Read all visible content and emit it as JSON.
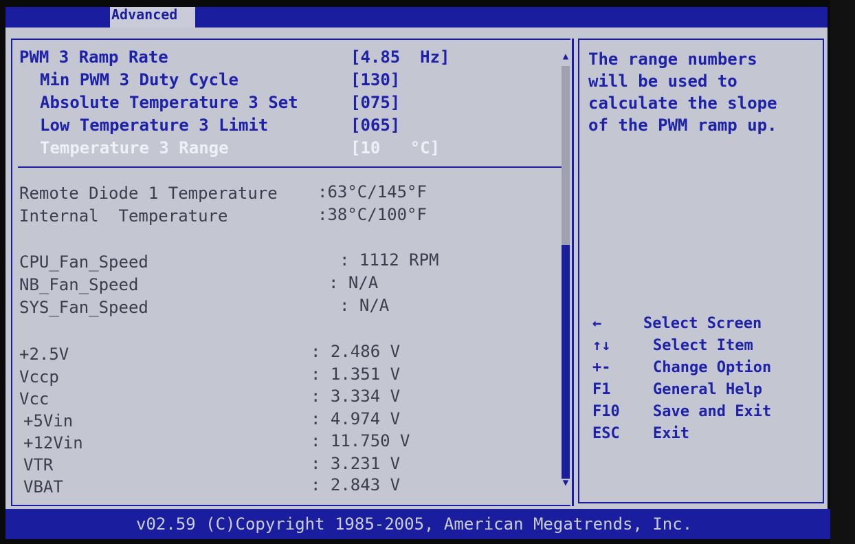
{
  "tab": {
    "label": "Advanced"
  },
  "settings": [
    {
      "name": "PWM 3 Ramp Rate",
      "value": "[4.85  Hz]"
    },
    {
      "name": "Min PWM 3 Duty Cycle",
      "value": "[130]"
    },
    {
      "name": "Absolute Temperature 3 Set",
      "value": "[075]"
    },
    {
      "name": "Low Temperature 3 Limit",
      "value": "[065]"
    },
    {
      "name": "Temperature 3 Range",
      "value": "[10   °C]"
    }
  ],
  "temperatures": [
    {
      "name": "Remote Diode 1 Temperature",
      "value": ":63°C/145°F"
    },
    {
      "name": "Internal  Temperature",
      "value": ":38°C/100°F"
    }
  ],
  "fans": [
    {
      "name": "CPU_Fan_Speed",
      "value": ": 1112 RPM"
    },
    {
      "name": "NB_Fan_Speed",
      "value": ": N/A"
    },
    {
      "name": "SYS_Fan_Speed",
      "value": ": N/A"
    }
  ],
  "voltages": [
    {
      "name": "+2.5V",
      "value": ": 2.486 V"
    },
    {
      "name": "Vccp",
      "value": ": 1.351 V"
    },
    {
      "name": "Vcc",
      "value": ": 3.334 V"
    },
    {
      "name": "+5Vin",
      "value": ": 4.974 V"
    },
    {
      "name": "+12Vin",
      "value": ": 11.750 V"
    },
    {
      "name": "VTR",
      "value": ": 3.231 V"
    },
    {
      "name": "VBAT",
      "value": ": 2.843 V"
    }
  ],
  "help_text": [
    "The range numbers",
    "will be used to",
    "calculate the slope",
    "of the PWM ramp up."
  ],
  "keys": [
    {
      "key": "←",
      "action": "Select Screen"
    },
    {
      "key": "↑↓",
      "action": "Select Item"
    },
    {
      "key": "+-",
      "action": "Change Option"
    },
    {
      "key": "F1",
      "action": "General Help"
    },
    {
      "key": "F10",
      "action": "Save and Exit"
    },
    {
      "key": "ESC",
      "action": "Exit"
    }
  ],
  "footer": {
    "copyright": "v02.59 (C)Copyright 1985-2005, American Megatrends, Inc."
  },
  "colors": {
    "bios_blue": "#1a1e9e",
    "panel_grey": "#c4c6d2",
    "highlight_white": "#eef0f8"
  }
}
